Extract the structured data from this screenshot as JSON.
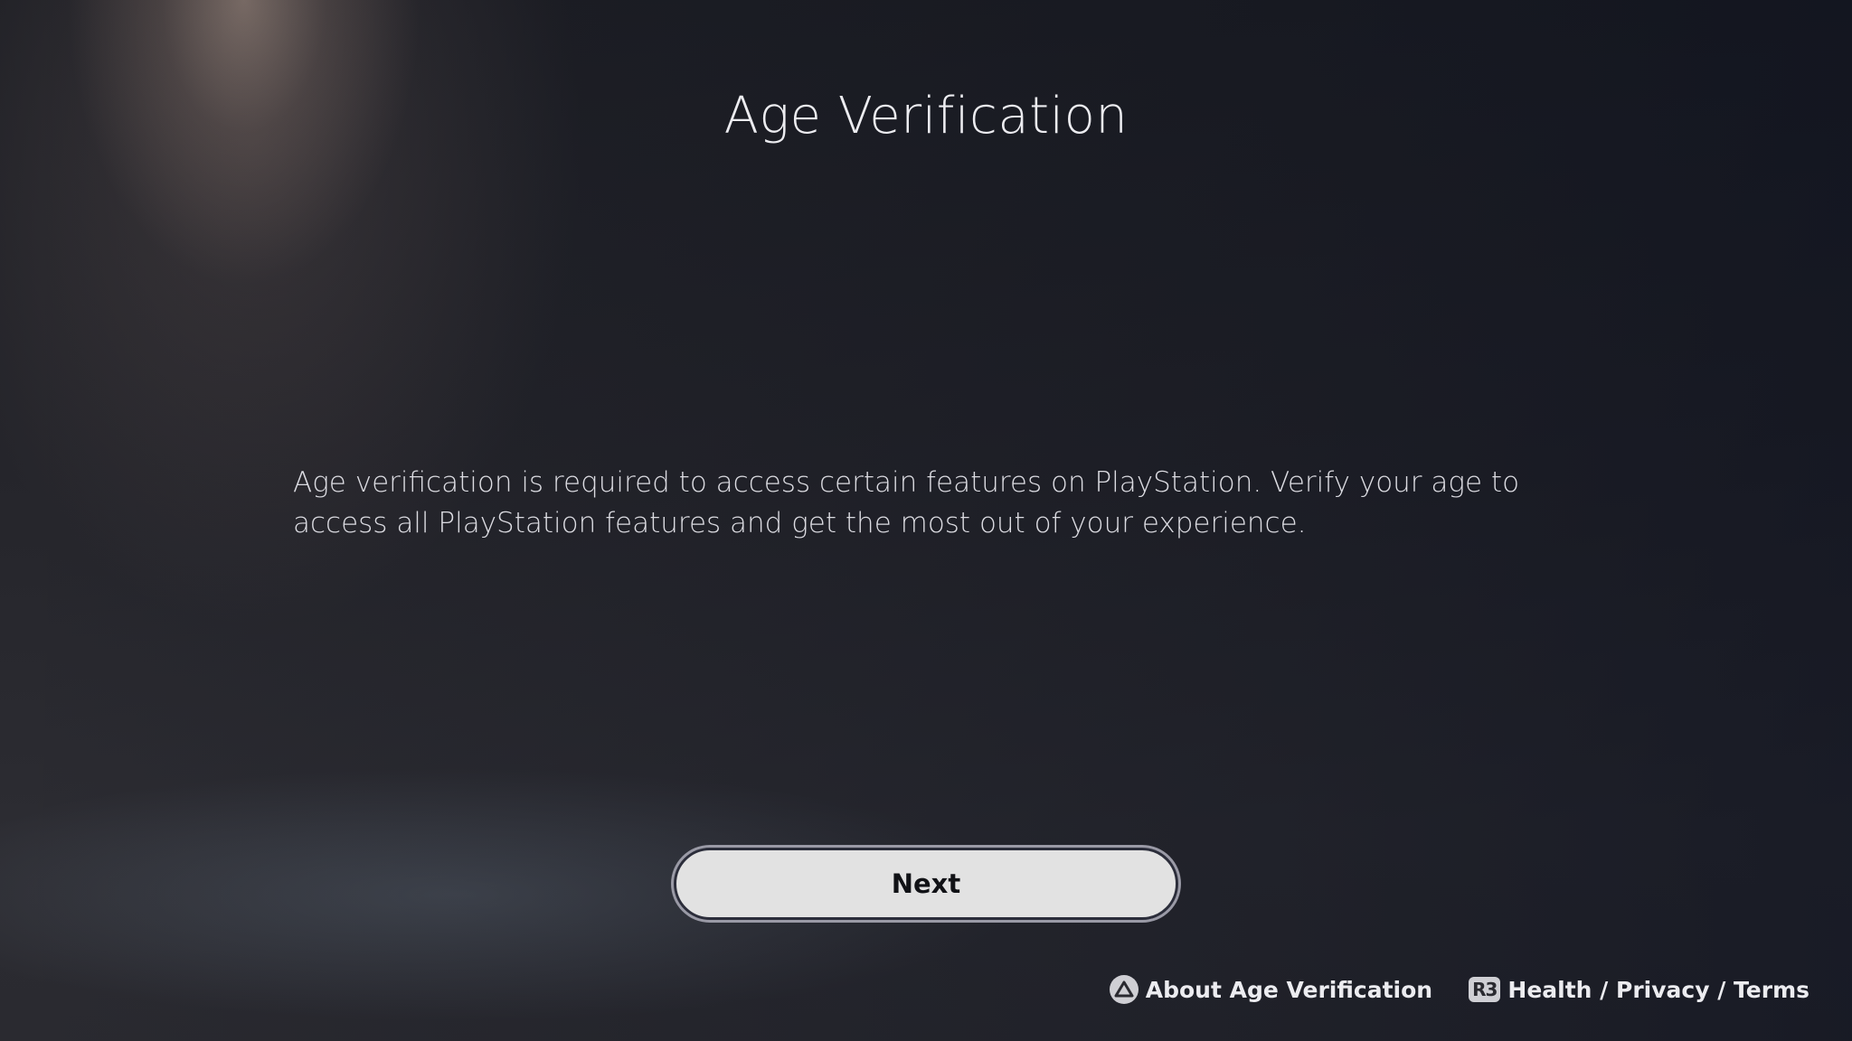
{
  "page": {
    "title": "Age Verification",
    "description": "Age verification is required to access certain features on PlayStation. Verify your age to access all PlayStation features and get the most out of your experience."
  },
  "actions": {
    "next_label": "Next"
  },
  "footer": {
    "about": {
      "icon": "triangle-button-icon",
      "label": "About Age Verification"
    },
    "legal": {
      "icon": "r3-button-icon",
      "icon_text": "R3",
      "label": "Health / Privacy / Terms"
    }
  },
  "colors": {
    "background": "#1b1c22",
    "button_fill": "#e2e2e2",
    "button_text": "#111216",
    "text": "#ececf0"
  }
}
